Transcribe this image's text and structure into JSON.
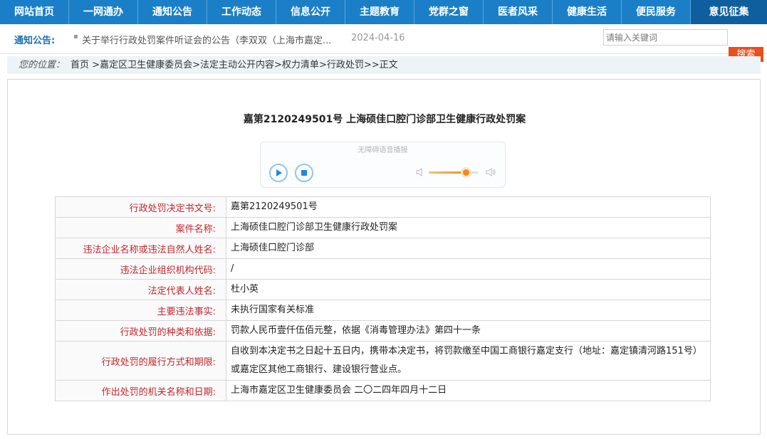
{
  "nav": {
    "items": [
      "网站首页",
      "一网通办",
      "通知公告",
      "工作动态",
      "信息公开",
      "主题教育",
      "党群之窗",
      "医者风采",
      "健康生活",
      "便民服务",
      "意见征集"
    ],
    "active_index": 10
  },
  "notice": {
    "label": "通知公告:",
    "text": "关于举行行政处罚案件听证会的公告（李双双（上海市嘉定...",
    "date": "2024-04-16"
  },
  "search": {
    "placeholder": "请输入关键词",
    "button": "搜索"
  },
  "breadcrumb": {
    "here": "您的位置：",
    "items": [
      "首页",
      "嘉定区卫生健康委员会",
      "法定主动公开内容",
      "权力清单",
      "行政处罚",
      "正文"
    ]
  },
  "article": {
    "title": "嘉第2120249501号  上海硕佳口腔门诊部卫生健康行政处罚案"
  },
  "player": {
    "caption": "无障碍语音播报",
    "volume_fraction": 0.75
  },
  "table": {
    "rows": [
      {
        "label": "行政处罚决定书文号:",
        "value": "嘉第2120249501号"
      },
      {
        "label": "案件名称:",
        "value": "上海硕佳口腔门诊部卫生健康行政处罚案"
      },
      {
        "label": "违法企业名称或违法自然人姓名:",
        "value": "上海硕佳口腔门诊部"
      },
      {
        "label": "违法企业组织机构代码:",
        "value": "/"
      },
      {
        "label": "法定代表人姓名:",
        "value": "杜小英"
      },
      {
        "label": "主要违法事实:",
        "value": "未执行国家有关标准"
      },
      {
        "label": "行政处罚的种类和依据:",
        "value": "罚款人民币壹仟伍佰元整，依据《消毒管理办法》第四十一条"
      },
      {
        "label": "行政处罚的履行方式和期限:",
        "value": "自收到本决定书之日起十五日内，携带本决定书，将罚款缴至中国工商银行嘉定支行（地址：嘉定镇清河路151号）或嘉定区其他工商银行、建设银行营业点。"
      },
      {
        "label": "作出处罚的机关名称和日期:",
        "value": "上海市嘉定区卫生健康委员会  二〇二四年四月十二日"
      }
    ]
  },
  "colors": {
    "nav_bg": "#1a7fc6",
    "nav_active": "#0f5f9e",
    "label_red": "#c0272d",
    "search_btn": "#e94e1b"
  }
}
